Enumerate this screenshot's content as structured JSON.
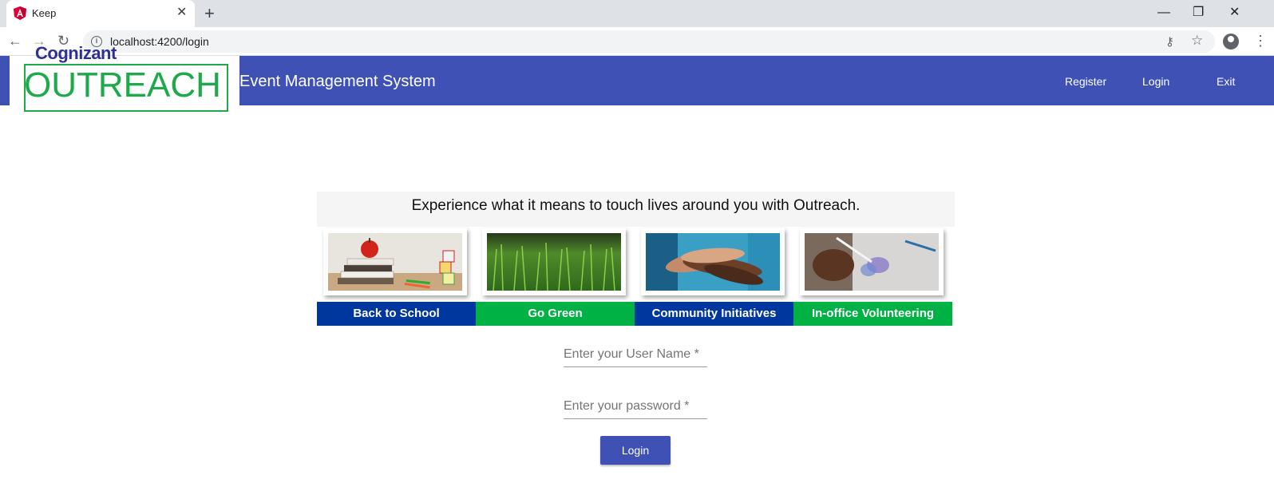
{
  "browser": {
    "tab_title": "Keep",
    "url": "localhost:4200/login",
    "new_tab": "+",
    "close_tab": "✕",
    "minimize": "—",
    "restore": "❐",
    "close_window": "✕",
    "back": "←",
    "forward": "→",
    "reload": "↻",
    "key": "⚷",
    "star": "☆",
    "menu": "⋮"
  },
  "header": {
    "logo_top": "Cognizant",
    "logo_main": "OUTREACH",
    "title": "Event Management System",
    "nav": [
      "Register",
      "Login",
      "Exit"
    ],
    "bg_color": "#3f51b5"
  },
  "banner": {
    "tagline": "Experience what it means to touch lives around you with Outreach.",
    "tiles": [
      {
        "label": "Back to School",
        "color": "#00379e",
        "image": "books-apple"
      },
      {
        "label": "Go Green",
        "color": "#00b144",
        "image": "grass"
      },
      {
        "label": "Community Initiatives",
        "color": "#00379e",
        "image": "hands"
      },
      {
        "label": "In-office Volunteering",
        "color": "#00b144",
        "image": "painting"
      }
    ]
  },
  "form": {
    "username_placeholder": "Enter your User Name *",
    "password_placeholder": "Enter your password *",
    "login_label": "Login"
  }
}
